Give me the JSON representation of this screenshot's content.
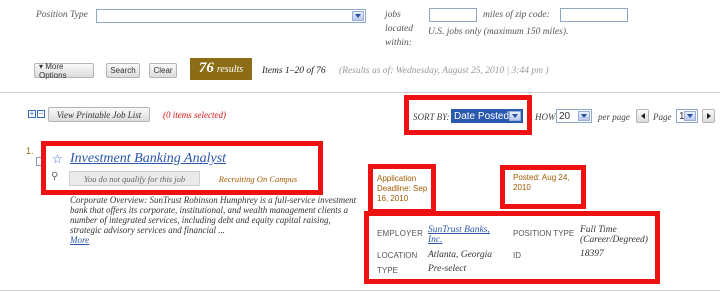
{
  "filters": {
    "position_type_label": "Position Type",
    "jobs_located_within_label": "jobs located within:",
    "miles_label": "miles of zip code:",
    "us_only_note": "U.S. jobs only (maximum 150 miles)."
  },
  "toolbar": {
    "more_options": "▾ More Options",
    "search": "Search",
    "clear": "Clear",
    "results_count": "76",
    "results_word": "results",
    "items_range": "Items 1–20 of 76",
    "results_asof": "(Results as of: Wednesday, August 25, 2010 | 3:44 pm )"
  },
  "listbar": {
    "printable": "View Printable Job List",
    "items_selected": "(0 items selected)",
    "sort_by_label": "SORT BY:",
    "sort_by_value": "Date Posted",
    "show_label": "HOW",
    "per_page_value": "20",
    "per_page_label": "per page",
    "page_label": "Page",
    "page_value": "1"
  },
  "job": {
    "index": "1.",
    "title": "Investment Banking Analyst",
    "qualify_text": "You do not qualify for this job",
    "recruiting_tag": "Recruiting On Campus",
    "description": "Corporate Overview: SunTrust Robinson Humphrey is a full-service investment bank that offers its corporate, institutional, and wealth management clients a number of integrated services, including debt and equity capital raising, strategic advisory services and financial ...",
    "more_link": "More",
    "deadline_label": "Application Deadline:",
    "deadline_value": "Sep 16, 2010",
    "posted_label": "Posted:",
    "posted_value": "Aug 24, 2010",
    "employer_label": "EMPLOYER",
    "employer_value": "SunTrust Banks, Inc.",
    "location_label": "LOCATION",
    "location_value": "Atlanta, Georgia",
    "type_label": "TYPE",
    "type_value": "Pre-select",
    "position_type_label": "POSITION TYPE",
    "position_type_value": "Full Time (Career/Degreed)",
    "id_label": "ID",
    "id_value": "18397"
  },
  "colors": {
    "highlight_border": "#ee1111",
    "results_badge": "#8c6d16",
    "link": "#2a55a8"
  }
}
